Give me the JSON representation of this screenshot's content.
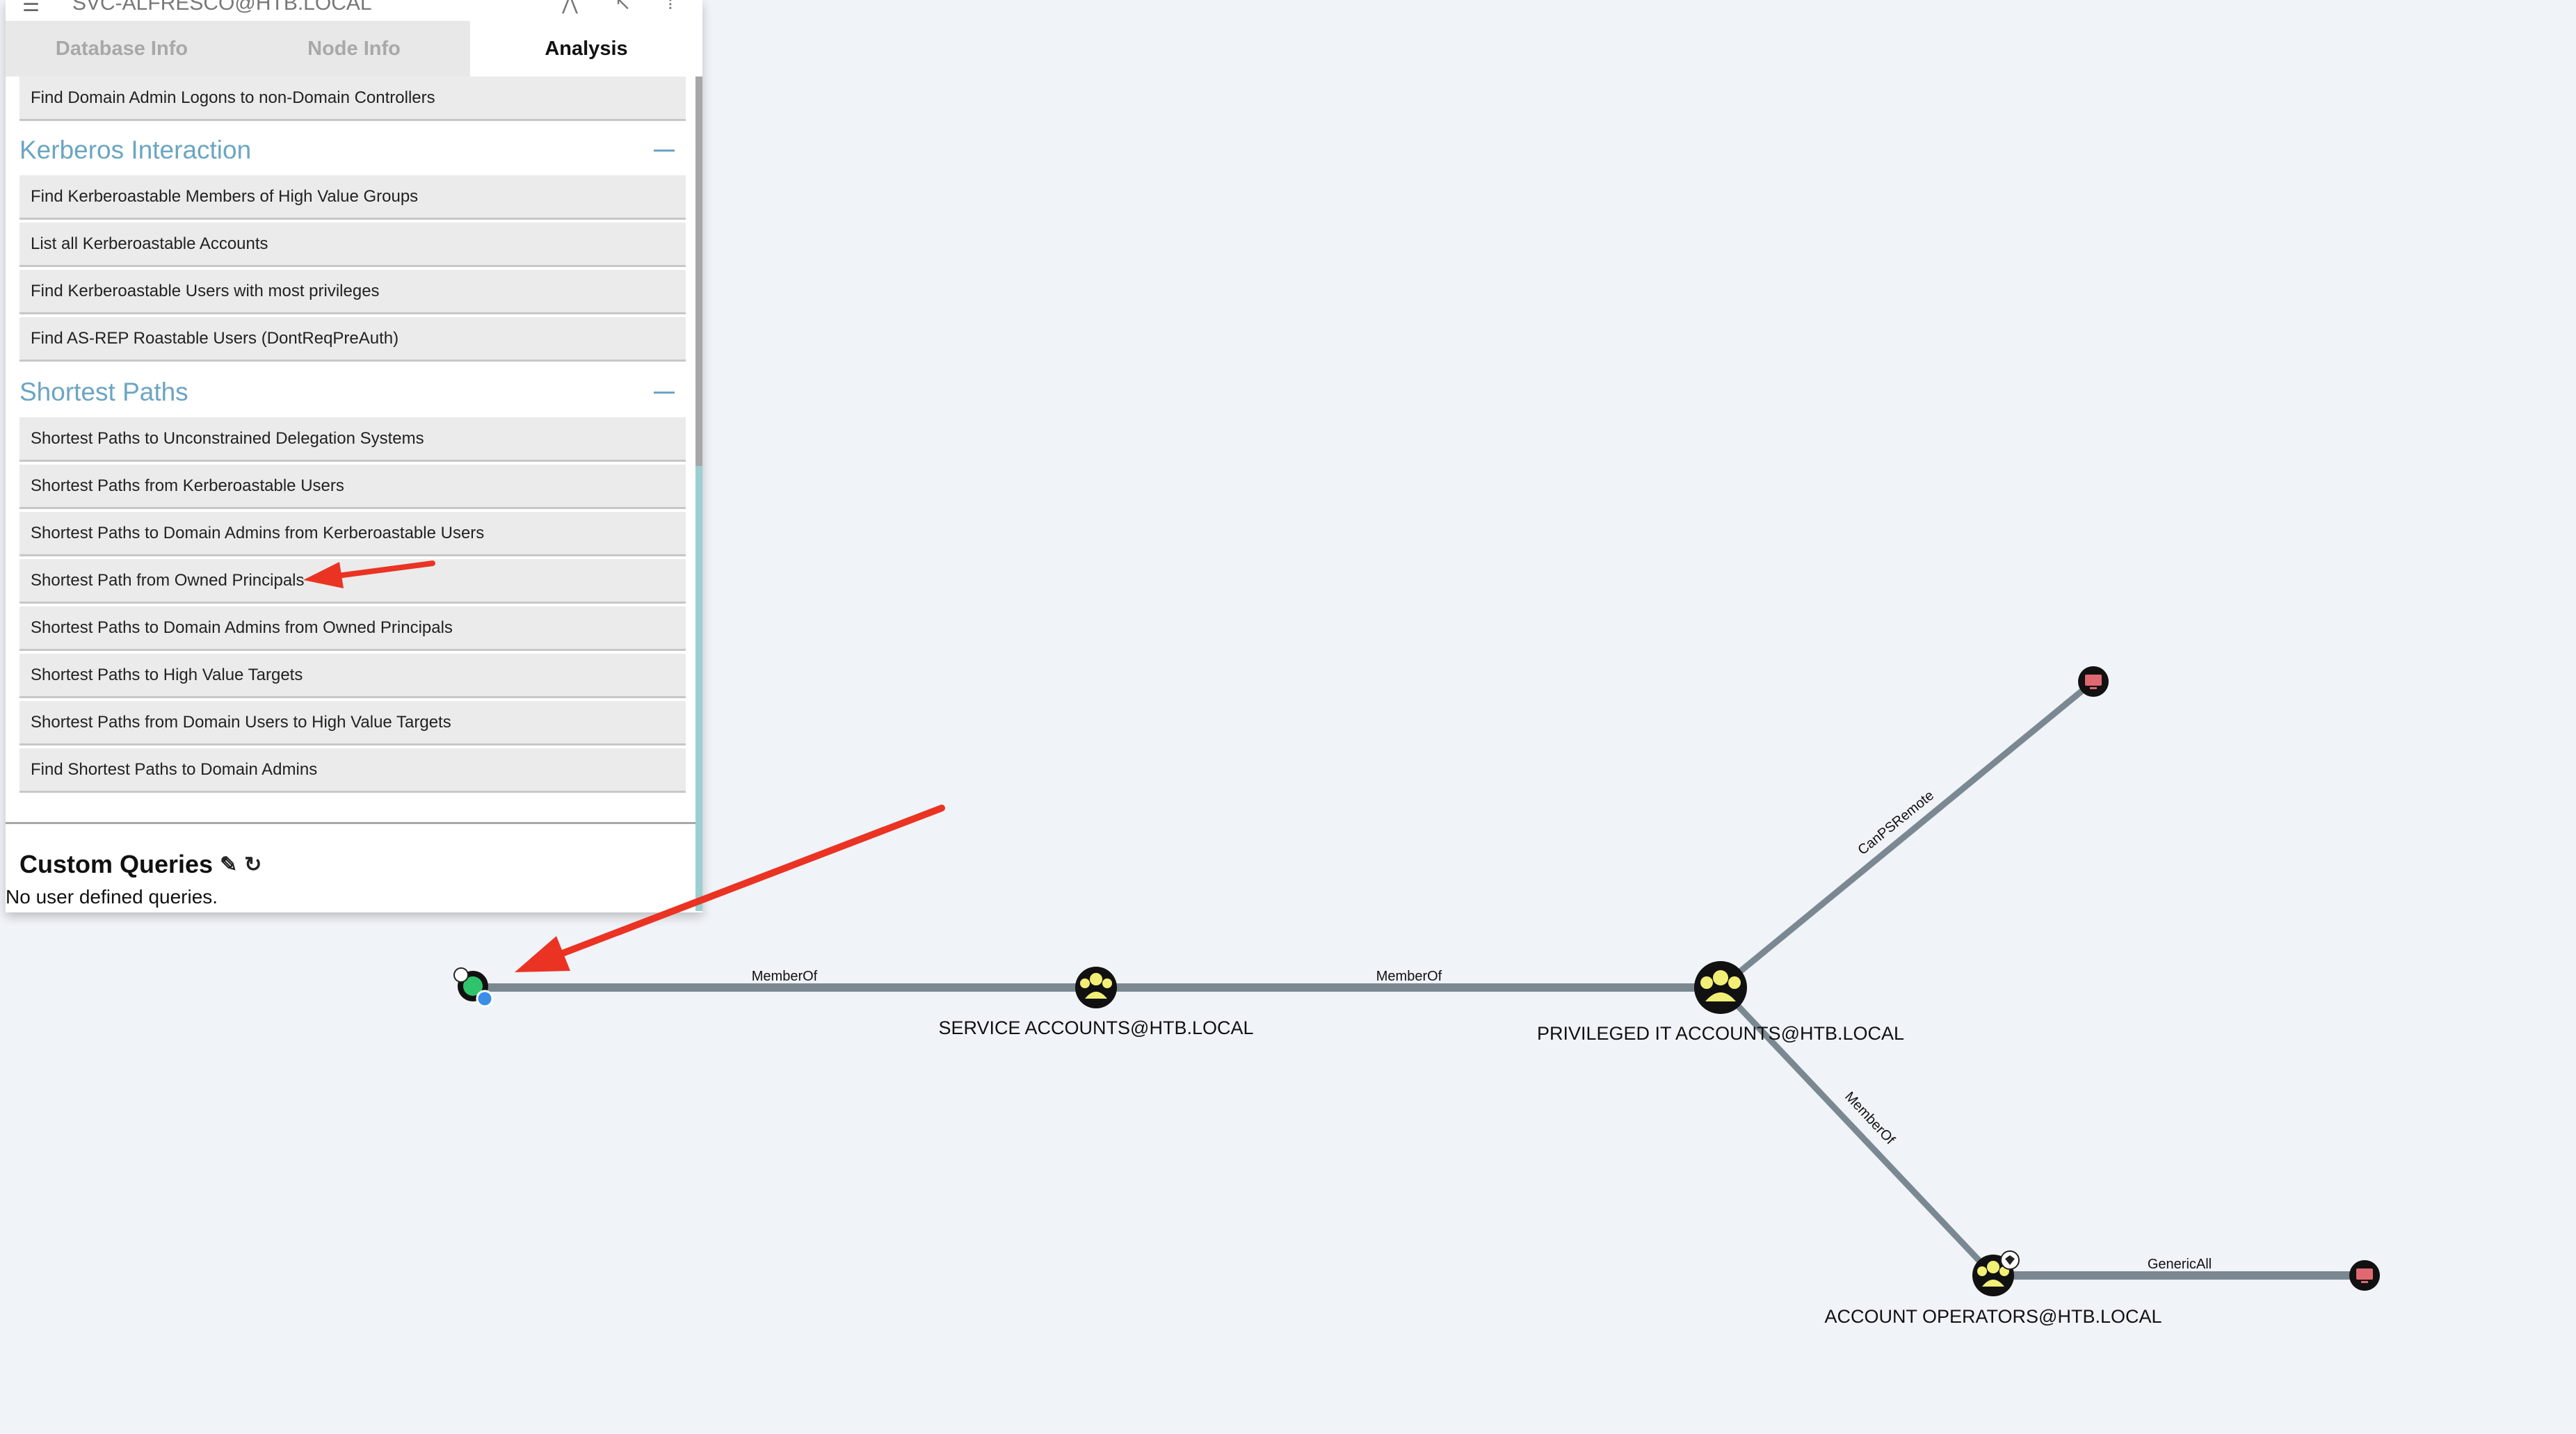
{
  "header": {
    "user": "SVC-ALFRESCO@HTB.LOCAL"
  },
  "tabs": [
    {
      "label": "Database Info"
    },
    {
      "label": "Node Info"
    },
    {
      "label": "Analysis"
    }
  ],
  "queries": {
    "top_item": "Find Domain Admin Logons to non-Domain Controllers",
    "kerberos": {
      "title": "Kerberos Interaction",
      "items": [
        "Find Kerberoastable Members of High Value Groups",
        "List all Kerberoastable Accounts",
        "Find Kerberoastable Users with most privileges",
        "Find AS-REP Roastable Users (DontReqPreAuth)"
      ]
    },
    "shortest": {
      "title": "Shortest Paths",
      "items": [
        "Shortest Paths to Unconstrained Delegation Systems",
        "Shortest Paths from Kerberoastable Users",
        "Shortest Paths to Domain Admins from Kerberoastable Users",
        "Shortest Path from Owned Principals",
        "Shortest Paths to Domain Admins from Owned Principals",
        "Shortest Paths to High Value Targets",
        "Shortest Paths from Domain Users to High Value Targets",
        "Find Shortest Paths to Domain Admins"
      ]
    }
  },
  "custom": {
    "title": "Custom Queries",
    "empty": "No user defined queries.",
    "edit_icon": "pencil-icon",
    "refresh_icon": "refresh-icon"
  },
  "graph": {
    "nodes": {
      "user": {
        "label": "",
        "icon": "user-icon"
      },
      "service": {
        "label": "SERVICE ACCOUNTS@HTB.LOCAL",
        "icon": "group-icon"
      },
      "privileged": {
        "label": "PRIVILEGED IT ACCOUNTS@HTB.LOCAL",
        "icon": "group-icon"
      },
      "operators": {
        "label": "ACCOUNT OPERATORS@HTB.LOCAL",
        "icon": "group-icon"
      },
      "computer1": {
        "label": "",
        "icon": "computer-icon"
      },
      "computer2": {
        "label": "",
        "icon": "computer-icon"
      }
    },
    "edges": {
      "e1": "MemberOf",
      "e2": "MemberOf",
      "e3": "CanPSRemote",
      "e4": "MemberOf",
      "e5": "GenericAll"
    },
    "colors": {
      "edge": "#7a8891",
      "group_node": "#f2ef76",
      "computer_node": "#e06971",
      "user_node": "#2fc46b",
      "annotation_arrow": "#ea3323"
    }
  }
}
